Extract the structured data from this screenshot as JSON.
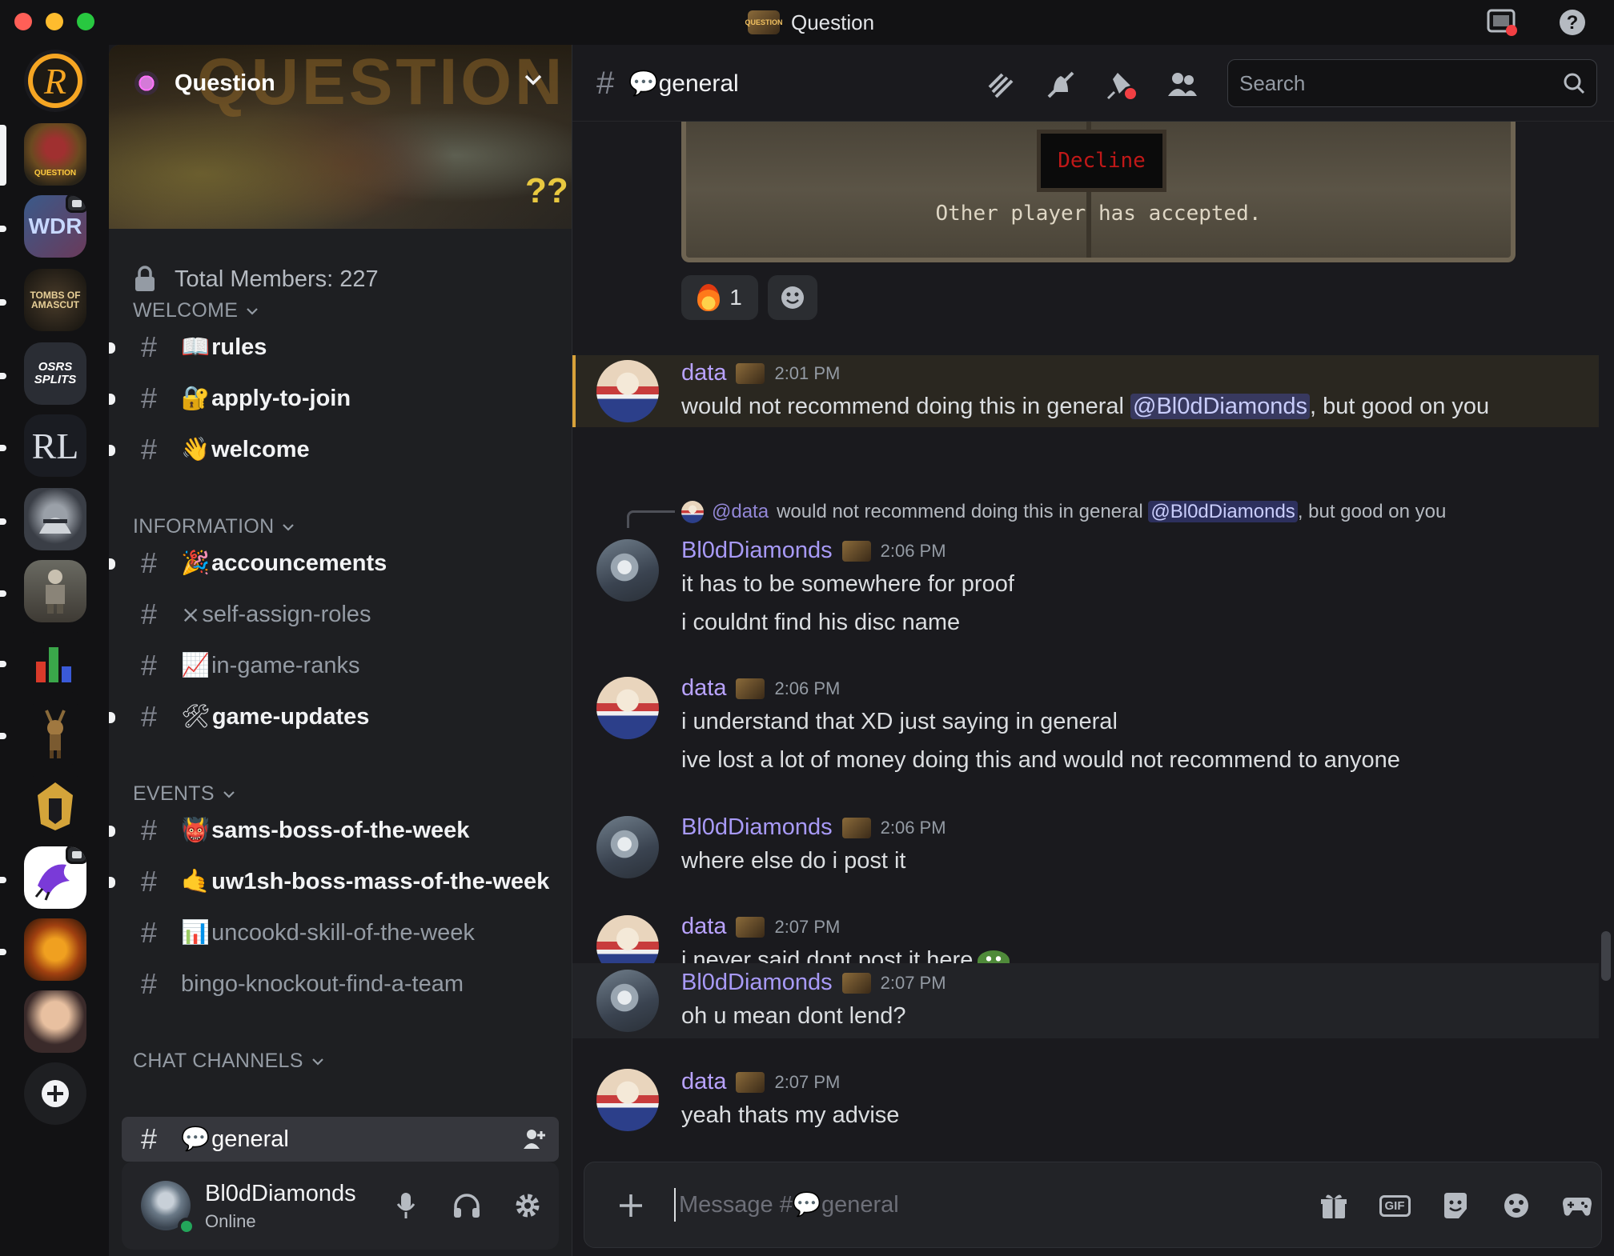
{
  "window": {
    "title": "Question",
    "server_tag": "QUESTION"
  },
  "servers": [
    {
      "name": "R",
      "label": "R"
    },
    {
      "name": "Question",
      "label": "QUESTION"
    },
    {
      "name": "WDR",
      "label": "WDR"
    },
    {
      "name": "Tombs of Amascut",
      "label": "TOMBS OF AMASCUT"
    },
    {
      "name": "OSRS Splits",
      "label": "OSRS SPLITS"
    },
    {
      "name": "RL",
      "label": "RL"
    }
  ],
  "sidebar": {
    "server_name": "Question",
    "banner_word": "QUESTION",
    "banner_marks": "??",
    "member_count": "Total Members: 227",
    "categories": {
      "welcome": "WELCOME",
      "information": "INFORMATION",
      "events": "EVENTS",
      "chat": "CHAT CHANNELS"
    },
    "channels": {
      "rules": {
        "emoji": "📖",
        "name": "rules"
      },
      "apply": {
        "emoji": "🔐",
        "name": "apply-to-join"
      },
      "welcome": {
        "emoji": "👋",
        "name": "welcome"
      },
      "announcements": {
        "emoji": "🎉",
        "name": "accouncements"
      },
      "roles": {
        "emoji": "⨯",
        "name": "self-assign-roles"
      },
      "ranks": {
        "emoji": "📈",
        "name": "in-game-ranks"
      },
      "updates": {
        "emoji": "🛠",
        "name": "game-updates"
      },
      "sams": {
        "emoji": "👹",
        "name": "sams-boss-of-the-week"
      },
      "uw1sh": {
        "emoji": "🤙",
        "name": "uw1sh-boss-mass-of-the-week"
      },
      "uncookd": {
        "emoji": "📊",
        "name": "uncookd-skill-of-the-week"
      },
      "bingo": {
        "emoji": "",
        "name": "bingo-knockout-find-a-team"
      },
      "general": {
        "emoji": "💬",
        "name": "general"
      }
    }
  },
  "user": {
    "name": "Bl0dDiamonds",
    "status": "Online"
  },
  "chat": {
    "channel_emoji": "💬",
    "channel_name": "general",
    "search_placeholder": "Search",
    "embed": {
      "button": "Decline",
      "text": "Other player has accepted."
    },
    "reaction_count": "1",
    "composer_placeholder": "Message #💬general",
    "messages": [
      {
        "user": "data",
        "time": "2:01 PM",
        "text_pre": "would not recommend doing this in general ",
        "mention": "@Bl0dDiamonds",
        "text_post": ", but good on you"
      },
      {
        "reply_user": "@data",
        "reply_pre": "would not recommend doing this in general ",
        "reply_mention": "@Bl0dDiamonds",
        "reply_post": ", but good on you",
        "user": "Bl0dDiamonds",
        "time": "2:06 PM",
        "lines": [
          "it has to be somewhere for proof",
          "i couldnt find his disc name"
        ]
      },
      {
        "user": "data",
        "time": "2:06 PM",
        "lines": [
          "i understand that XD just saying in general",
          "ive lost a lot of money doing this and would not recommend to anyone"
        ]
      },
      {
        "user": "Bl0dDiamonds",
        "time": "2:06 PM",
        "text": "where else do i post it"
      },
      {
        "user": "data",
        "time": "2:07 PM",
        "text": "i never said dont post it here"
      },
      {
        "user": "Bl0dDiamonds",
        "time": "2:07 PM",
        "text": "oh u mean dont lend?"
      },
      {
        "user": "data",
        "time": "2:07 PM",
        "text": "yeah thats my advise"
      }
    ]
  },
  "icons": {
    "threads": "threads-icon",
    "mute": "bell-slash-icon",
    "pins": "pin-icon",
    "members": "members-icon",
    "gift": "gift-icon",
    "gif": "GIF",
    "sticker": "sticker-icon",
    "emoji": "emoji-icon",
    "activity": "gamepad-icon"
  },
  "colors": {
    "username_data": "#b9a3ff",
    "username_blod": "#a89af7",
    "mention_bg": "#5865f2",
    "online": "#23a55a",
    "highlight_bar": "#d8a23a"
  }
}
